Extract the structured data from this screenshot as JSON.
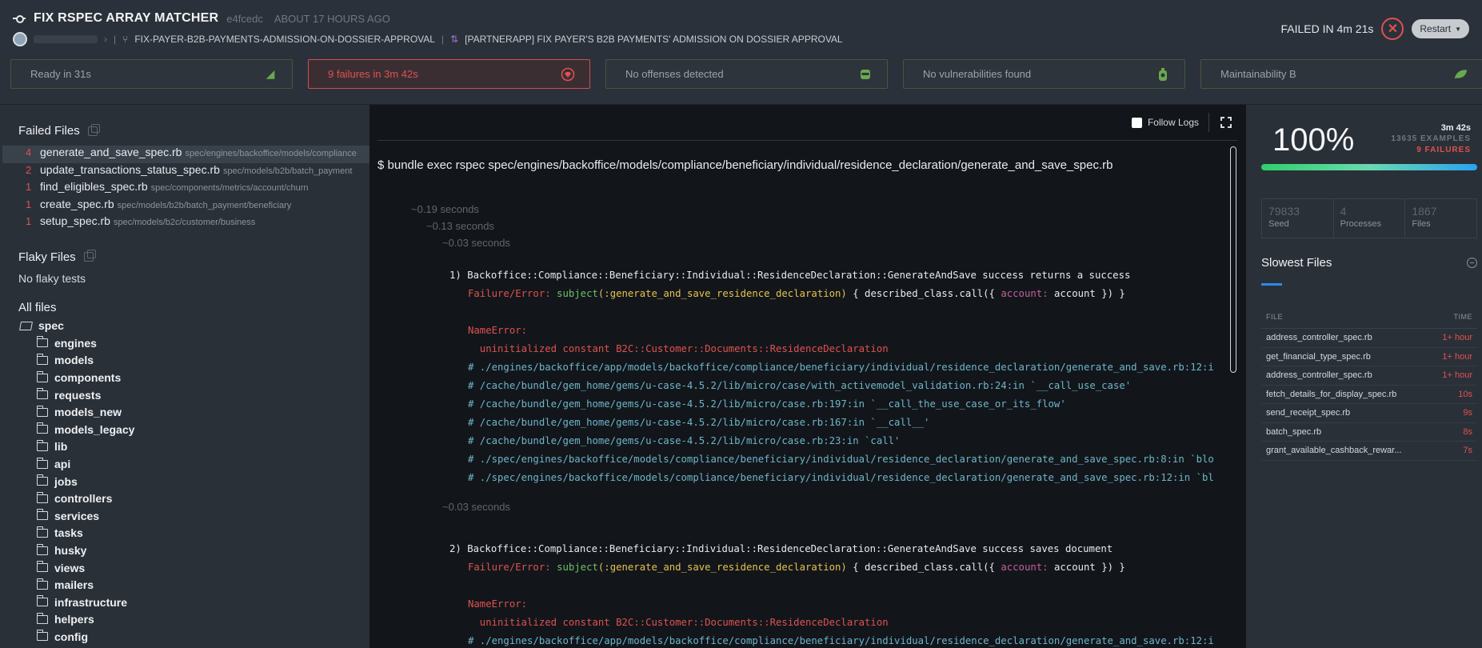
{
  "header": {
    "title": "FIX RSPEC ARRAY MATCHER",
    "sha": "e4fcedc",
    "ago": "ABOUT 17 HOURS AGO",
    "branch": "FIX-PAYER-B2B-PAYMENTS-ADMISSION-ON-DOSSIER-APPROVAL",
    "pr_title": "[PARTNERAPP] FIX PAYER'S B2B PAYMENTS' ADMISSION ON DOSSIER APPROVAL",
    "status_text": "FAILED IN 4m 21s",
    "restart_label": "Restart"
  },
  "badges": [
    {
      "label": "Ready in 31s",
      "icon": "docker-icon",
      "state": "ok"
    },
    {
      "label": "9 failures in 3m 42s",
      "icon": "rspec-icon",
      "state": "fail"
    },
    {
      "label": "No offenses detected",
      "icon": "rubocop-icon",
      "state": "ok"
    },
    {
      "label": "No vulnerabilities found",
      "icon": "brakeman-icon",
      "state": "ok"
    },
    {
      "label": "Maintainability B",
      "icon": "leaf-icon",
      "state": "ok"
    }
  ],
  "sidebar": {
    "failed_title": "Failed Files",
    "failed_files": [
      {
        "count": "4",
        "name": "generate_and_save_spec.rb",
        "path": "spec/engines/backoffice/models/compliance"
      },
      {
        "count": "2",
        "name": "update_transactions_status_spec.rb",
        "path": "spec/models/b2b/batch_payment"
      },
      {
        "count": "1",
        "name": "find_eligibles_spec.rb",
        "path": "spec/components/metrics/account/churn"
      },
      {
        "count": "1",
        "name": "create_spec.rb",
        "path": "spec/models/b2b/batch_payment/beneficiary"
      },
      {
        "count": "1",
        "name": "setup_spec.rb",
        "path": "spec/models/b2c/customer/business"
      }
    ],
    "flaky_title": "Flaky Files",
    "no_flaky": "No flaky tests",
    "all_title": "All files",
    "root": "spec",
    "folders": [
      "engines",
      "models",
      "components",
      "requests",
      "models_new",
      "models_legacy",
      "lib",
      "api",
      "jobs",
      "controllers",
      "services",
      "tasks",
      "husky",
      "views",
      "mailers",
      "infrastructure",
      "helpers",
      "config"
    ]
  },
  "console": {
    "follow_logs": "Follow Logs",
    "command": "$ bundle exec rspec spec/engines/backoffice/models/compliance/beneficiary/individual/residence_declaration/generate_and_save_spec.rb",
    "t1": "~0.19 seconds",
    "t2": "~0.13 seconds",
    "t3": "~0.03 seconds",
    "f1_title": "1) Backoffice::Compliance::Beneficiary::Individual::ResidenceDeclaration::GenerateAndSave success returns a success",
    "failure_prefix": "Failure/Error: ",
    "subject_kw": "subject",
    "subject_arg": "(:generate_and_save_residence_declaration)",
    "call_pre": " { described_class.call({ ",
    "account_kw": "account:",
    "call_post": " account }) }",
    "name_error": "NameError:",
    "uninit": "  uninitialized constant B2C::Customer::Documents::ResidenceDeclaration",
    "bt": [
      "# ./engines/backoffice/app/models/backoffice/compliance/beneficiary/individual/residence_declaration/generate_and_save.rb:12:i",
      "# /cache/bundle/gem_home/gems/u-case-4.5.2/lib/micro/case/with_activemodel_validation.rb:24:in `__call_use_case'",
      "# /cache/bundle/gem_home/gems/u-case-4.5.2/lib/micro/case.rb:197:in `__call_the_use_case_or_its_flow'",
      "# /cache/bundle/gem_home/gems/u-case-4.5.2/lib/micro/case.rb:167:in `__call__'",
      "# /cache/bundle/gem_home/gems/u-case-4.5.2/lib/micro/case.rb:23:in `call'",
      "# ./spec/engines/backoffice/models/compliance/beneficiary/individual/residence_declaration/generate_and_save_spec.rb:8:in `blo",
      "# ./spec/engines/backoffice/models/compliance/beneficiary/individual/residence_declaration/generate_and_save_spec.rb:12:in `bl"
    ],
    "t4": "~0.03 seconds",
    "f2_title": "2) Backoffice::Compliance::Beneficiary::Individual::ResidenceDeclaration::GenerateAndSave success saves document",
    "bt2_first": "# ./engines/backoffice/app/models/backoffice/compliance/beneficiary/individual/residence_declaration/generate_and_save.rb:12:i"
  },
  "right": {
    "percent": "100%",
    "time": "3m 42s",
    "examples": "13635 EXAMPLES",
    "failures": "9 FAILURES",
    "seed_val": "79833",
    "seed_lbl": "Seed",
    "proc_val": "4",
    "proc_lbl": "Processes",
    "files_val": "1867",
    "files_lbl": "Files",
    "slowest_title": "Slowest Files",
    "col_file": "FILE",
    "col_time": "TIME",
    "slowest": [
      {
        "name": "address_controller_spec.rb",
        "time": "1+ hour"
      },
      {
        "name": "get_financial_type_spec.rb",
        "time": "1+ hour"
      },
      {
        "name": "address_controller_spec.rb",
        "time": "1+ hour"
      },
      {
        "name": "fetch_details_for_display_spec.rb",
        "time": "10s"
      },
      {
        "name": "send_receipt_spec.rb",
        "time": "9s"
      },
      {
        "name": "batch_spec.rb",
        "time": "8s"
      },
      {
        "name": "grant_available_cashback_rewar...",
        "time": "7s"
      }
    ]
  }
}
